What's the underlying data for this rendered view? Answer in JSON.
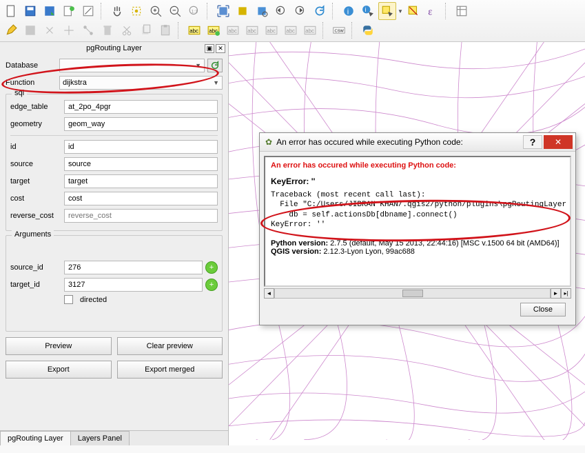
{
  "panel": {
    "title": "pgRouting Layer",
    "database_label": "Database",
    "database_value": "",
    "function_label": "Function",
    "function_value": "dijkstra"
  },
  "sql": {
    "title": "sql",
    "edge_table_label": "edge_table",
    "edge_table_value": "at_2po_4pgr",
    "geometry_label": "geometry",
    "geometry_value": "geom_way",
    "id_label": "id",
    "id_value": "id",
    "source_label": "source",
    "source_value": "source",
    "target_label": "target",
    "target_value": "target",
    "cost_label": "cost",
    "cost_value": "cost",
    "reverse_cost_label": "reverse_cost",
    "reverse_cost_placeholder": "reverse_cost"
  },
  "args": {
    "title": "Arguments",
    "source_id_label": "source_id",
    "source_id_value": "276",
    "target_id_label": "target_id",
    "target_id_value": "3127",
    "directed_label": "directed"
  },
  "buttons": {
    "preview": "Preview",
    "clear_preview": "Clear preview",
    "export": "Export",
    "export_merged": "Export merged"
  },
  "tabs": {
    "tab1": "pgRouting Layer",
    "tab2": "Layers Panel"
  },
  "dialog": {
    "title": "An error has occured while executing Python code:",
    "err_head": "An error has occured while executing Python code:",
    "key_error": "KeyError: ''",
    "trace1": "Traceback (most recent call last):",
    "trace2": "  File \"C:/Users/JIBRAN KHAN/.qgis2/python/plugins\\pgRoutingLayer",
    "trace3": "    db = self.actionsDb[dbname].connect()",
    "trace4": "KeyError: ''",
    "py_label": "Python version:",
    "py_value": " 2.7.5 (default, May 15 2013, 22:44:16) [MSC v.1500 64 bit (AMD64)]",
    "qgis_label": "QGIS version:",
    "qgis_value": " 2.12.3-Lyon Lyon, 99ac688",
    "close": "Close"
  }
}
